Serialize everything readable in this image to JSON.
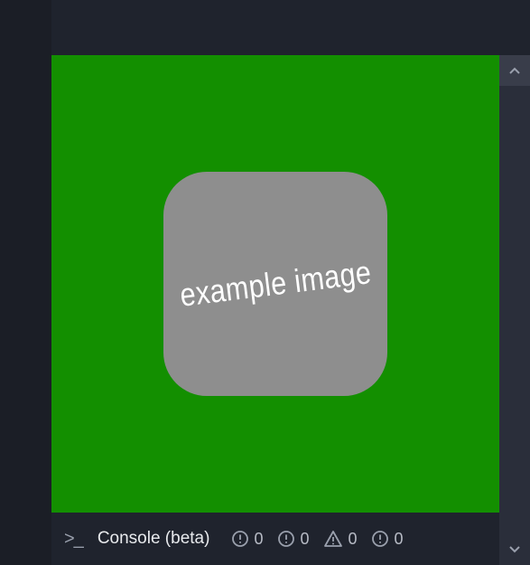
{
  "preview": {
    "tile_label": "example image",
    "background_color": "#138f00",
    "tile_color": "#8e8e8e"
  },
  "scrollbar": {
    "up_glyph": "⌃",
    "down_glyph": "⌄"
  },
  "console": {
    "prompt_glyph": ">_",
    "label": "Console (beta)",
    "stats": {
      "errors": 0,
      "info": 0,
      "warnings": 0,
      "other": 0
    }
  }
}
